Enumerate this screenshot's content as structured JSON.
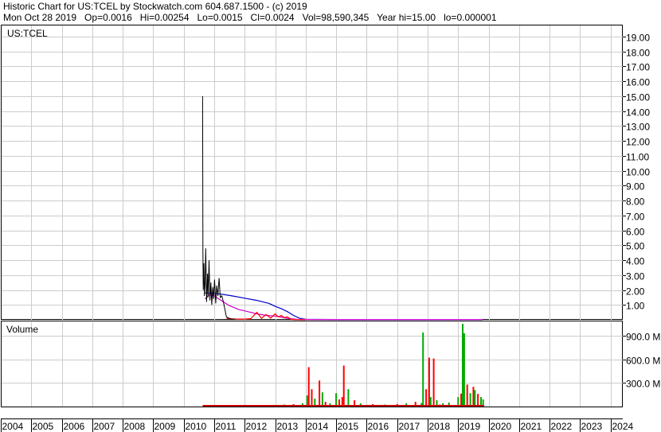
{
  "header": {
    "line1": "Historic Chart for US:TCEL by Stockwatch.com 604.687.1500 - (c) 2019",
    "line2": "Mon Oct 28 2019   Op=0.0016   Hi=0.00254   Lo=0.0015   Cl=0.0024   Vol=98,590,345   Year hi=15.00   lo=0.000001"
  },
  "chart_data": [
    {
      "type": "line",
      "title": "US:TCEL",
      "y_ticks": [
        "1.00",
        "2.00",
        "3.00",
        "4.00",
        "5.00",
        "6.00",
        "7.00",
        "8.00",
        "9.00",
        "10.00",
        "11.00",
        "12.00",
        "13.00",
        "14.00",
        "15.00",
        "16.00",
        "17.00",
        "18.00",
        "19.00"
      ],
      "ylim": [
        0,
        19.8
      ],
      "x_ticks": [
        "2004",
        "2005",
        "2006",
        "2007",
        "2008",
        "2009",
        "2010",
        "2011",
        "2012",
        "2013",
        "2014",
        "2015",
        "2016",
        "2017",
        "2018",
        "2019",
        "2020",
        "2021",
        "2022",
        "2023",
        "2024"
      ],
      "xlim": [
        2004.0,
        2024.4
      ],
      "grid": true,
      "series": [
        {
          "kind": "price",
          "color": "#000000",
          "x": [
            2010.62,
            2010.63,
            2010.64,
            2010.66,
            2010.68,
            2010.7,
            2010.72,
            2010.75,
            2010.78,
            2010.8,
            2010.83,
            2010.86,
            2010.89,
            2010.92,
            2010.95,
            2010.98,
            2011.01,
            2011.05,
            2011.08,
            2011.12,
            2011.16,
            2011.2,
            2011.25,
            2011.3,
            2011.4,
            2011.55,
            2011.7
          ],
          "y": [
            15.0,
            4.5,
            2.0,
            3.8,
            1.6,
            2.4,
            4.8,
            1.2,
            3.1,
            1.5,
            4.0,
            1.3,
            2.5,
            1.0,
            2.2,
            1.4,
            2.7,
            1.1,
            2.3,
            1.6,
            2.8,
            1.5,
            1.6,
            1.2,
            0.2,
            0.05,
            0.03
          ]
        },
        {
          "kind": "price-lows",
          "color": "#ff0000",
          "x": [
            2011.4,
            2011.7,
            2012.0,
            2012.2,
            2012.4,
            2012.55,
            2012.7,
            2012.85,
            2013.0,
            2013.1,
            2013.2,
            2013.3,
            2013.4,
            2013.5,
            2013.6,
            2013.8,
            2014.0
          ],
          "y": [
            0.1,
            0.05,
            0.05,
            0.08,
            0.5,
            0.1,
            0.35,
            0.12,
            0.4,
            0.2,
            0.3,
            0.15,
            0.2,
            0.05,
            0.02,
            0.01,
            0.01
          ]
        },
        {
          "kind": "moving-average-long",
          "color": "#0000cc",
          "x": [
            2010.7,
            2010.9,
            2011.1,
            2011.3,
            2011.6,
            2012.0,
            2012.4,
            2012.8,
            2013.0,
            2013.2,
            2013.4,
            2013.6,
            2013.8,
            2014.0,
            2015.0,
            2016.0,
            2017.0,
            2018.0,
            2019.0,
            2019.8
          ],
          "y": [
            1.8,
            1.8,
            1.75,
            1.7,
            1.6,
            1.45,
            1.3,
            1.1,
            0.9,
            0.75,
            0.55,
            0.3,
            0.1,
            0.03,
            0.02,
            0.02,
            0.02,
            0.02,
            0.02,
            0.02
          ]
        },
        {
          "kind": "moving-average-short",
          "color": "#cc00cc",
          "x": [
            2010.7,
            2010.85,
            2011.0,
            2011.15,
            2011.3,
            2011.5,
            2011.8,
            2012.1,
            2012.4,
            2012.7,
            2013.0,
            2013.2,
            2013.4,
            2013.7,
            2014.0,
            2016.0,
            2018.0,
            2019.8
          ],
          "y": [
            1.4,
            1.7,
            1.6,
            1.4,
            1.2,
            0.95,
            0.7,
            0.55,
            0.4,
            0.3,
            0.25,
            0.18,
            0.1,
            0.04,
            0.02,
            0.02,
            0.02,
            0.02
          ]
        }
      ]
    },
    {
      "type": "bar",
      "title": "Volume",
      "y_ticks": [
        "300.0 M",
        "600.0 M",
        "900.0 M"
      ],
      "ylim": [
        0,
        1080
      ],
      "unit": "M",
      "x": [
        2011.0,
        2011.5,
        2012.0,
        2012.5,
        2013.0,
        2013.3,
        2013.6,
        2013.9,
        2014.05,
        2014.1,
        2014.2,
        2014.3,
        2014.45,
        2014.55,
        2014.65,
        2014.8,
        2015.0,
        2015.1,
        2015.2,
        2015.25,
        2015.4,
        2015.6,
        2015.8,
        2016.2,
        2016.6,
        2017.0,
        2017.3,
        2017.6,
        2017.8,
        2017.85,
        2017.95,
        2018.05,
        2018.1,
        2018.2,
        2018.3,
        2018.4,
        2018.5,
        2018.7,
        2019.0,
        2019.1,
        2019.15,
        2019.2,
        2019.3,
        2019.4,
        2019.5,
        2019.55,
        2019.65,
        2019.75,
        2019.82
      ],
      "values": [
        15,
        8,
        10,
        12,
        18,
        25,
        30,
        40,
        140,
        500,
        220,
        100,
        330,
        180,
        60,
        40,
        170,
        90,
        120,
        520,
        220,
        80,
        40,
        30,
        25,
        30,
        40,
        60,
        45,
        940,
        220,
        620,
        120,
        610,
        80,
        25,
        40,
        50,
        120,
        165,
        1050,
        930,
        280,
        170,
        250,
        210,
        160,
        120,
        90
      ],
      "colors": [
        "#ff0000",
        "#00aa00",
        "#ff0000",
        "#00aa00",
        "#ff0000",
        "#00aa00",
        "#ff0000",
        "#00aa00",
        "#00aa00",
        "#ff0000",
        "#ff0000",
        "#00aa00",
        "#ff0000",
        "#00aa00",
        "#ff0000",
        "#00aa00",
        "#00aa00",
        "#ff0000",
        "#ff0000",
        "#ff0000",
        "#00aa00",
        "#ff0000",
        "#00aa00",
        "#ff0000",
        "#00aa00",
        "#ff0000",
        "#00aa00",
        "#ff0000",
        "#00aa00",
        "#00aa00",
        "#ff0000",
        "#ff0000",
        "#00aa00",
        "#ff0000",
        "#00aa00",
        "#ff0000",
        "#00aa00",
        "#00aa00",
        "#00aa00",
        "#ff0000",
        "#00aa00",
        "#00aa00",
        "#ff0000",
        "#00aa00",
        "#ff0000",
        "#00aa00",
        "#ff0000",
        "#00aa00",
        "#00aa00"
      ]
    }
  ]
}
